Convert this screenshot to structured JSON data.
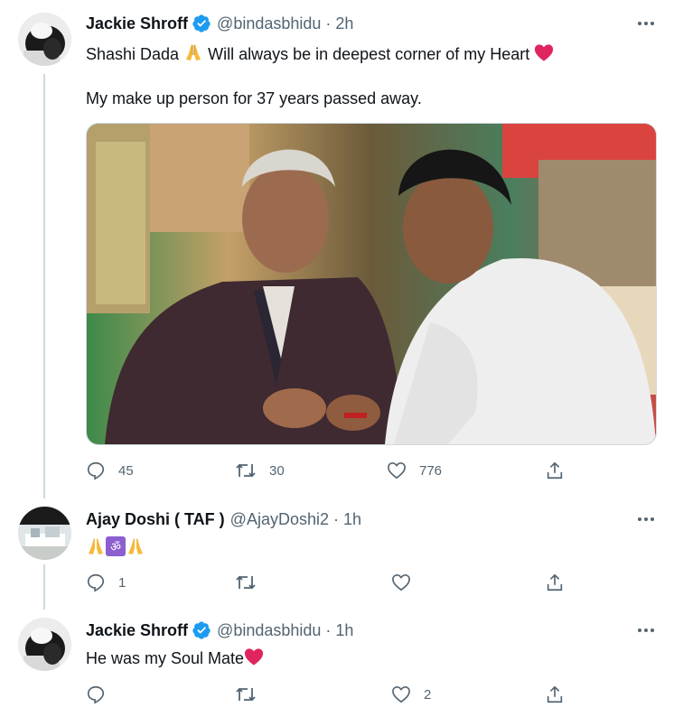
{
  "tweets": [
    {
      "author": "Jackie Shroff",
      "handle": "@bindasbhidu",
      "time": "2h",
      "line1": "Shashi Dada ",
      "line1b": "Will always be in deepest corner of my Heart",
      "line2": "My make up person for 37 years passed away.",
      "replies": "45",
      "retweets": "30",
      "likes": "776"
    },
    {
      "author": "Ajay Doshi ( TAF )",
      "handle": "@AjayDoshi2",
      "time": "1h",
      "replies": "1",
      "retweets": "",
      "likes": ""
    },
    {
      "author": "Jackie Shroff",
      "handle": "@bindasbhidu",
      "time": "1h",
      "line1": "He was my Soul Mate",
      "replies": "",
      "retweets": "",
      "likes": "2"
    }
  ],
  "colors": {
    "verified": "#1d9bf0",
    "heart": "#e0245e",
    "icon": "#536471",
    "thread_line": "#cfd9de",
    "om_box": "#8c5fd1"
  },
  "icons": [
    "verified-icon",
    "more-icon",
    "reply-icon",
    "retweet-icon",
    "like-icon",
    "share-icon",
    "red-heart-emoji",
    "folded-hands-emoji",
    "om-emoji"
  ]
}
